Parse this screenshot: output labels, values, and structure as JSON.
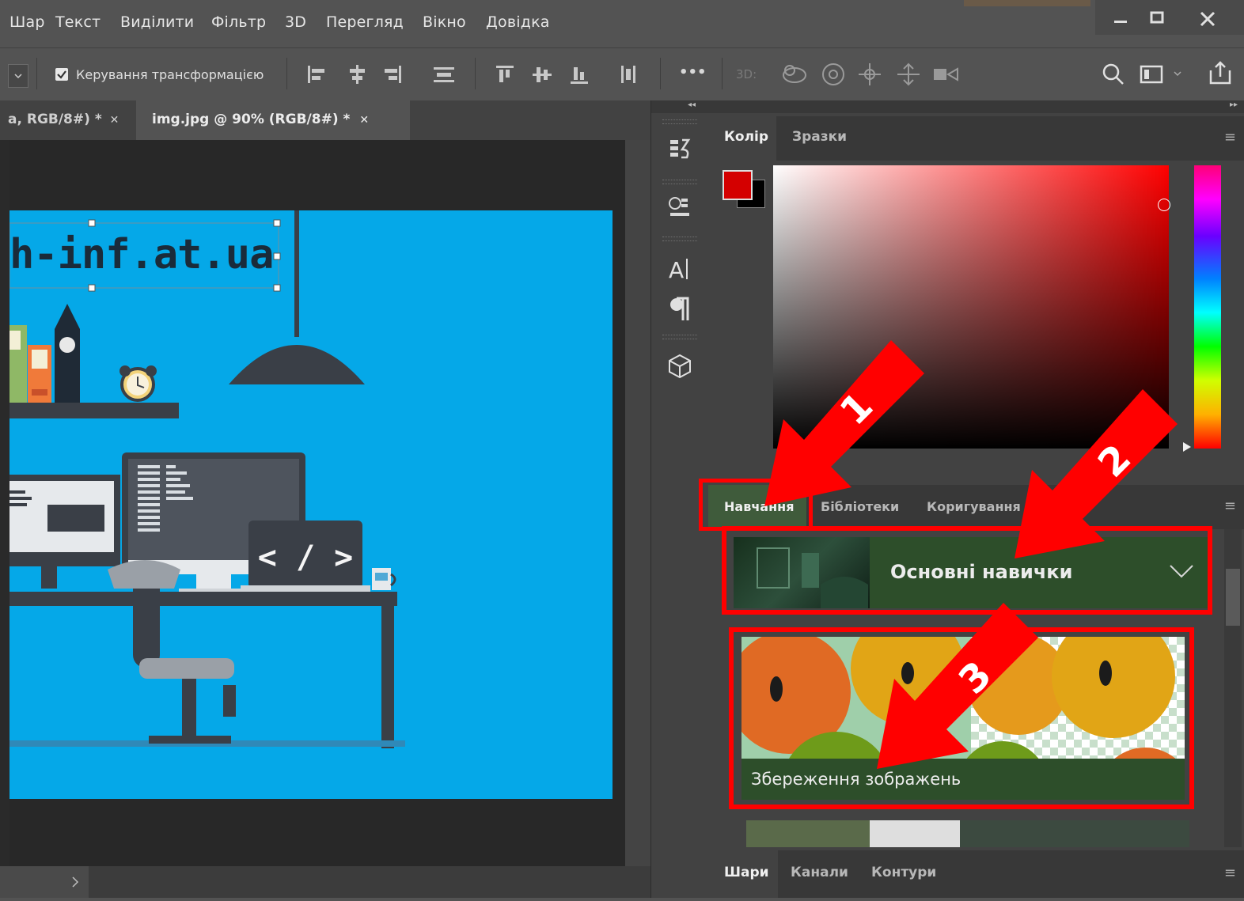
{
  "menu": {
    "items": [
      "Шар",
      "Текст",
      "Виділити",
      "Фільтр",
      "3D",
      "Перегляд",
      "Вікно",
      "Довідка"
    ]
  },
  "options_bar": {
    "transform_label": "Керування трансформацією",
    "transform_checked": true,
    "label_3d": "3D:",
    "more": "•••"
  },
  "document_tabs": [
    {
      "label": "a, RGB/8#) *",
      "close": "✕"
    },
    {
      "label": "img.jpg @ 90% (RGB/8#) *",
      "close": "✕"
    }
  ],
  "artwork": {
    "site_text": "h-inf.at.ua",
    "code_tag": "< / >"
  },
  "color_panel": {
    "tabs": [
      "Колір",
      "Зразки"
    ],
    "foreground": "#d40000",
    "background": "#000000"
  },
  "learn_panel": {
    "tabs": [
      "Навчання",
      "Бібліотеки",
      "Коригування"
    ],
    "section_title": "Основні навички",
    "card_title": "Збереження зображень"
  },
  "layers_panel": {
    "tabs": [
      "Шари",
      "Канали",
      "Контури"
    ]
  },
  "annotations": {
    "labels": [
      "1",
      "2",
      "3"
    ],
    "color": "#ff0000"
  },
  "colors": {
    "ui_bg": "#535353",
    "panel_bg": "#424242",
    "canvas_bg": "#282828",
    "artboard": "#05a8e8",
    "learn_green": "#2d4e2a"
  }
}
